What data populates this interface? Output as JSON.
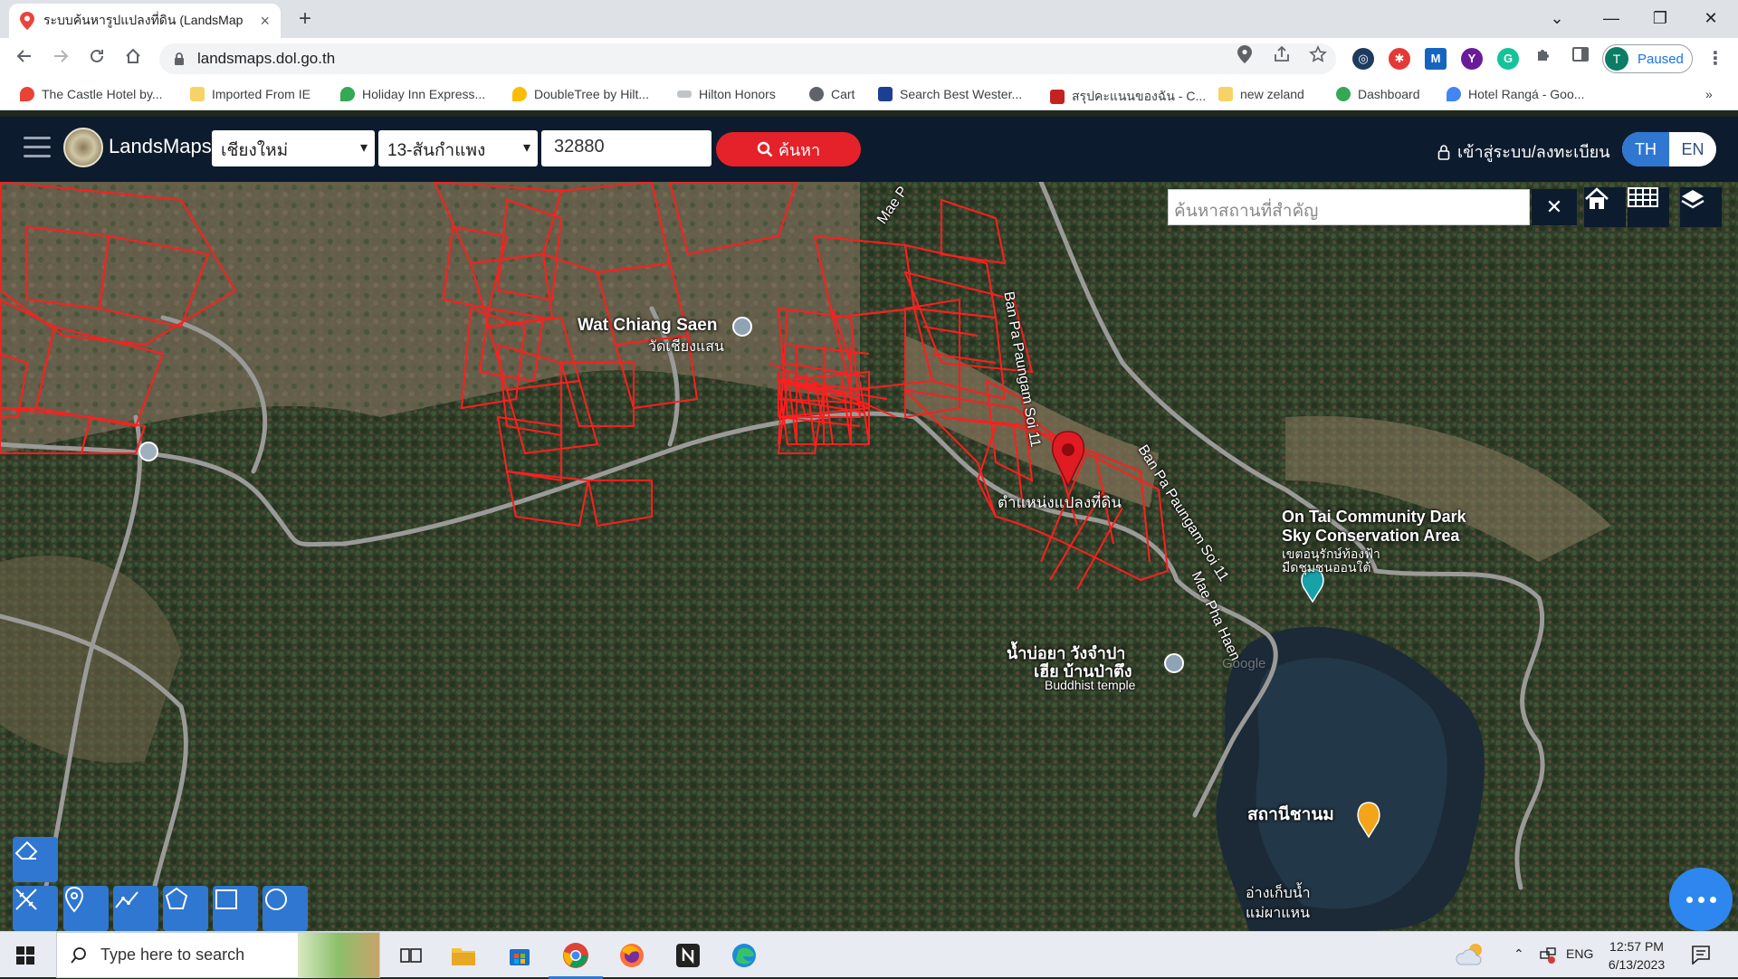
{
  "browser": {
    "tab_title": "ระบบค้นหารูปแปลงที่ดิน (LandsMaps",
    "tab_close": "×",
    "new_tab": "+",
    "url": "landsmaps.dol.go.th",
    "profile_initial": "T",
    "profile_status": "Paused",
    "window_controls": {
      "minimize": "—",
      "restore": "❐",
      "close": "✕",
      "dropdown": "⌄"
    },
    "bookmarks": [
      {
        "label": "The Castle Hotel by...",
        "icon": "maps-pin-icon",
        "color": "#ea4335"
      },
      {
        "label": "Imported From IE",
        "icon": "folder-icon",
        "color": "#f6d365"
      },
      {
        "label": "Holiday Inn Express...",
        "icon": "maps-pin-icon",
        "color": "#34a853"
      },
      {
        "label": "DoubleTree by Hilt...",
        "icon": "maps-pin-icon",
        "color": "#fbbc05"
      },
      {
        "label": "Hilton Honors",
        "icon": "hilton-icon",
        "color": "#9aa0a6"
      },
      {
        "label": "Cart",
        "icon": "globe-icon",
        "color": "#5f6368"
      },
      {
        "label": "Search Best Wester...",
        "icon": "bestwestern-icon",
        "color": "#1c3f94"
      },
      {
        "label": "สรุปคะแนนของฉัน - C...",
        "icon": "c-logo-icon",
        "color": "#c5221f"
      },
      {
        "label": "new zeland",
        "icon": "folder-icon",
        "color": "#f6d365"
      },
      {
        "label": "Dashboard",
        "icon": "dashboard-icon",
        "color": "#34a853"
      },
      {
        "label": "Hotel Rangá - Goo...",
        "icon": "maps-pin-icon",
        "color": "#4285f4"
      }
    ],
    "bookmarks_more": "»"
  },
  "app": {
    "brand": "LandsMaps",
    "province": "เชียงใหม่",
    "district": "13-สันกำแพง",
    "parcel_number": "32880",
    "search_label": "ค้นหา",
    "login_label": "เข้าสู่ระบบ/ลงทะเบียน",
    "lang_th": "TH",
    "lang_en": "EN",
    "colors": {
      "header": "#0d1b2e",
      "search": "#e5222a",
      "accent": "#2f77d0",
      "parcel": "#ff1e1e"
    }
  },
  "map": {
    "place_search_placeholder": "ค้นหาสถานที่สำคัญ",
    "place_clear": "✕",
    "labels": {
      "wat_chiang_saen": "Wat Chiang Saen",
      "wat_chiang_saen_th": "วัดเชียงแสน",
      "parcel_location": "ตำแหน่งแปลงที่ดิน",
      "road_soi11": "Ban Pa Paungam Soi 11",
      "road_soi11_b": "Ban Pa Paungam Soi 11",
      "mae_pha_haen": "Mae Pha Haen",
      "mae_p": "Mae P",
      "on_tai_1": "On Tai Community Dark",
      "on_tai_2": "Sky Conservation Area",
      "on_tai_th_1": "เขตอนุรักษ์ท้องฟ้า",
      "on_tai_th_2": "มืดชุมชนออนใต้",
      "temple_th_1": "น้ำบ่อยา วังจำปา",
      "temple_th_2": "เฮีย บ้านป่าตึง",
      "temple_en": "Buddhist temple",
      "sathani": "สถานีชานม",
      "reservoir_1": "อ่างเก็บน้ำ",
      "reservoir_2": "แม่ผาแหน",
      "google": "Google"
    }
  },
  "taskbar": {
    "search_placeholder": "Type here to search",
    "lang": "ENG",
    "time": "12:57 PM",
    "date": "6/13/2023"
  }
}
